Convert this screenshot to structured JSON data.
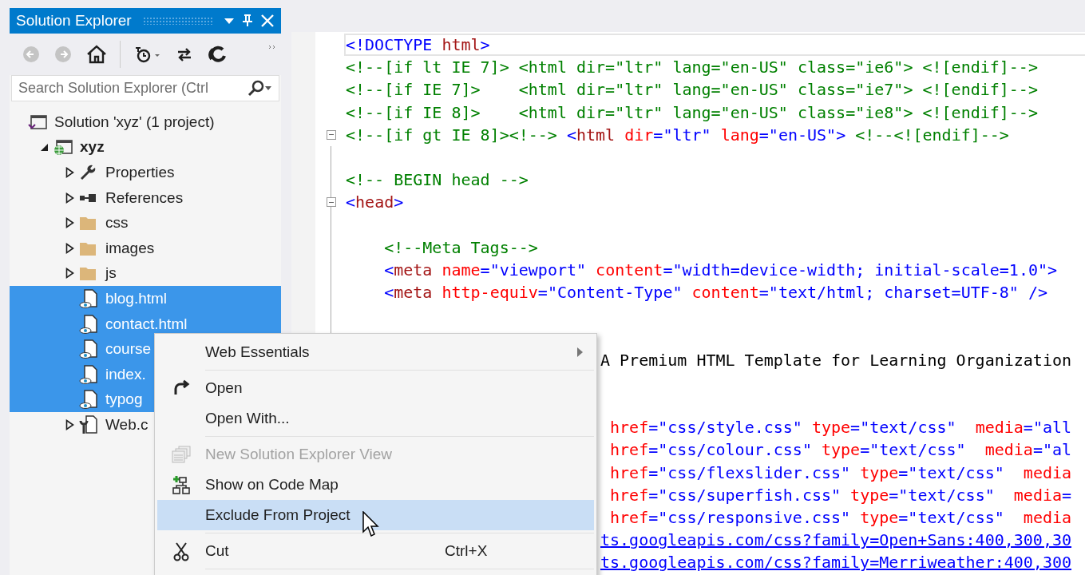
{
  "solution_explorer": {
    "title": "Solution Explorer",
    "toolbar": [
      {
        "kind": "back",
        "disabled": true
      },
      {
        "kind": "forward",
        "disabled": true
      },
      {
        "kind": "home",
        "disabled": false
      },
      {
        "kind": "separator"
      },
      {
        "kind": "history",
        "disabled": false
      },
      {
        "kind": "sync",
        "disabled": false
      },
      {
        "kind": "refresh",
        "disabled": false
      }
    ],
    "search": {
      "placeholder": "Search Solution Explorer (Ctrl"
    },
    "tree": [
      {
        "label": "Solution 'xyz' (1 project)",
        "kind": "solution",
        "selected": false,
        "children": [
          {
            "label": "xyz",
            "kind": "web-project",
            "bold": true,
            "expanded": true,
            "selected": false,
            "children": [
              {
                "label": "Properties",
                "kind": "wrench",
                "expanded": false,
                "selected": false
              },
              {
                "label": "References",
                "kind": "references",
                "expanded": false,
                "selected": false
              },
              {
                "label": "css",
                "kind": "folder",
                "expanded": false,
                "selected": false
              },
              {
                "label": "images",
                "kind": "folder",
                "expanded": false,
                "selected": false
              },
              {
                "label": "js",
                "kind": "folder",
                "expanded": false,
                "selected": false
              },
              {
                "label": "blog.html",
                "kind": "html-file",
                "selected": true
              },
              {
                "label": "contact.html",
                "kind": "html-file",
                "selected": true
              },
              {
                "label": "course",
                "kind": "html-file",
                "selected": true
              },
              {
                "label": "index.",
                "kind": "html-file",
                "selected": true
              },
              {
                "label": "typog",
                "kind": "html-file",
                "selected": true
              },
              {
                "label": "Web.c",
                "kind": "config-file",
                "expanded": false,
                "selected": false
              }
            ]
          }
        ]
      }
    ]
  },
  "editor": {
    "lines": [
      {
        "kind": "code",
        "current": true,
        "tokens": [
          {
            "kind": "tag",
            "text": "<!DOCTYPE"
          },
          {
            "kind": "name",
            "text": " html"
          },
          {
            "kind": "tag",
            "text": ">"
          }
        ]
      },
      {
        "kind": "code",
        "tokens": [
          {
            "kind": "comment",
            "text": "<!--[if lt IE 7]> <html dir=\"ltr\" lang=\"en-US\" class=\"ie6\"> <![endif]-->"
          }
        ]
      },
      {
        "kind": "code",
        "tokens": [
          {
            "kind": "comment",
            "text": "<!--[if IE 7]>    <html dir=\"ltr\" lang=\"en-US\" class=\"ie7\"> <![endif]-->"
          }
        ]
      },
      {
        "kind": "code",
        "tokens": [
          {
            "kind": "comment",
            "text": "<!--[if IE 8]>    <html dir=\"ltr\" lang=\"en-US\" class=\"ie8\"> <![endif]-->"
          }
        ]
      },
      {
        "kind": "code",
        "fold": true,
        "tokens": [
          {
            "kind": "comment",
            "text": "<!--[if gt IE 8]><!-->"
          },
          {
            "kind": "tag",
            "text": " <"
          },
          {
            "kind": "name",
            "text": "html"
          },
          {
            "kind": "attr",
            "text": " dir"
          },
          {
            "kind": "tag",
            "text": "=\"ltr\""
          },
          {
            "kind": "attr",
            "text": " lang"
          },
          {
            "kind": "tag",
            "text": "=\"en-US\">"
          },
          {
            "kind": "comment",
            "text": " <!--<![endif]-->"
          }
        ]
      },
      {
        "kind": "blank"
      },
      {
        "kind": "code",
        "tokens": [
          {
            "kind": "comment",
            "text": "<!-- BEGIN head -->"
          }
        ]
      },
      {
        "kind": "code",
        "fold": true,
        "tokens": [
          {
            "kind": "tag",
            "text": "<"
          },
          {
            "kind": "name",
            "text": "head"
          },
          {
            "kind": "tag",
            "text": ">"
          }
        ]
      },
      {
        "kind": "blank"
      },
      {
        "kind": "code",
        "tokens": [
          {
            "kind": "comment",
            "text": "    <!--Meta Tags-->"
          }
        ]
      },
      {
        "kind": "code",
        "tokens": [
          {
            "kind": "tag",
            "text": "    <"
          },
          {
            "kind": "name",
            "text": "meta"
          },
          {
            "kind": "attr",
            "text": " name"
          },
          {
            "kind": "tag",
            "text": "=\"viewport\""
          },
          {
            "kind": "attr",
            "text": " content"
          },
          {
            "kind": "tag",
            "text": "=\"width=device-width; initial-scale=1.0\">"
          }
        ]
      },
      {
        "kind": "code",
        "tokens": [
          {
            "kind": "tag",
            "text": "    <"
          },
          {
            "kind": "name",
            "text": "meta"
          },
          {
            "kind": "attr",
            "text": " http-equiv"
          },
          {
            "kind": "tag",
            "text": "=\"Content-Type\""
          },
          {
            "kind": "attr",
            "text": " content"
          },
          {
            "kind": "tag",
            "text": "=\"text/html; charset=UTF-8\" />"
          }
        ]
      },
      {
        "kind": "blank"
      },
      {
        "kind": "blank"
      },
      {
        "kind": "partial",
        "tokens": [
          {
            "kind": "text",
            "text": "A Premium HTML Template for Learning Organization"
          }
        ]
      },
      {
        "kind": "blank"
      },
      {
        "kind": "blank"
      },
      {
        "kind": "partial",
        "tokens": [
          {
            "kind": "attr",
            "text": " href"
          },
          {
            "kind": "tag",
            "text": "=\"css/style.css\""
          },
          {
            "kind": "attr",
            "text": " type"
          },
          {
            "kind": "tag",
            "text": "=\"text/css\""
          },
          {
            "kind": "attr",
            "text": "  media"
          },
          {
            "kind": "tag",
            "text": "=\"all"
          }
        ]
      },
      {
        "kind": "partial",
        "tokens": [
          {
            "kind": "attr",
            "text": " href"
          },
          {
            "kind": "tag",
            "text": "=\"css/colour.css\""
          },
          {
            "kind": "attr",
            "text": " type"
          },
          {
            "kind": "tag",
            "text": "=\"text/css\""
          },
          {
            "kind": "attr",
            "text": "  media"
          },
          {
            "kind": "tag",
            "text": "=\"al"
          }
        ]
      },
      {
        "kind": "partial",
        "tokens": [
          {
            "kind": "attr",
            "text": " href"
          },
          {
            "kind": "tag",
            "text": "=\"css/flexslider.css\""
          },
          {
            "kind": "attr",
            "text": " type"
          },
          {
            "kind": "tag",
            "text": "=\"text/css\""
          },
          {
            "kind": "attr",
            "text": "  media"
          }
        ]
      },
      {
        "kind": "partial",
        "tokens": [
          {
            "kind": "attr",
            "text": " href"
          },
          {
            "kind": "tag",
            "text": "=\"css/superfish.css\""
          },
          {
            "kind": "attr",
            "text": " type"
          },
          {
            "kind": "tag",
            "text": "=\"text/css\""
          },
          {
            "kind": "attr",
            "text": "  media"
          },
          {
            "kind": "tag",
            "text": "="
          }
        ]
      },
      {
        "kind": "partial",
        "tokens": [
          {
            "kind": "attr",
            "text": " href"
          },
          {
            "kind": "tag",
            "text": "=\"css/responsive.css\""
          },
          {
            "kind": "attr",
            "text": " type"
          },
          {
            "kind": "tag",
            "text": "=\"text/css\""
          },
          {
            "kind": "attr",
            "text": "  media"
          }
        ]
      },
      {
        "kind": "partial",
        "tokens": [
          {
            "kind": "link",
            "text": "ts.googleapis.com/css?family=Open+Sans:400,300,30"
          }
        ]
      },
      {
        "kind": "partial",
        "tokens": [
          {
            "kind": "link",
            "text": "ts.googleapis.com/css?family=Merriweather:400,300"
          }
        ]
      }
    ]
  },
  "context_menu": {
    "items": [
      {
        "kind": "item",
        "label": "Web Essentials",
        "submenu": true,
        "disabled": false,
        "selected": false
      },
      {
        "kind": "separator"
      },
      {
        "kind": "item",
        "label": "Open",
        "submenu": false,
        "disabled": false,
        "selected": false
      },
      {
        "kind": "item",
        "label": "Open With...",
        "submenu": false,
        "disabled": false,
        "selected": false
      },
      {
        "kind": "separator"
      },
      {
        "kind": "item",
        "label": "New Solution Explorer View",
        "submenu": false,
        "disabled": true,
        "selected": false
      },
      {
        "kind": "item",
        "label": "Show on Code Map",
        "submenu": false,
        "disabled": false,
        "selected": false
      },
      {
        "kind": "item",
        "label": "Exclude From Project",
        "submenu": false,
        "disabled": false,
        "selected": true
      },
      {
        "kind": "separator"
      },
      {
        "kind": "item",
        "label": "Cut",
        "shortcut": "Ctrl+X",
        "submenu": false,
        "disabled": false,
        "selected": false
      },
      {
        "kind": "separator"
      }
    ]
  }
}
